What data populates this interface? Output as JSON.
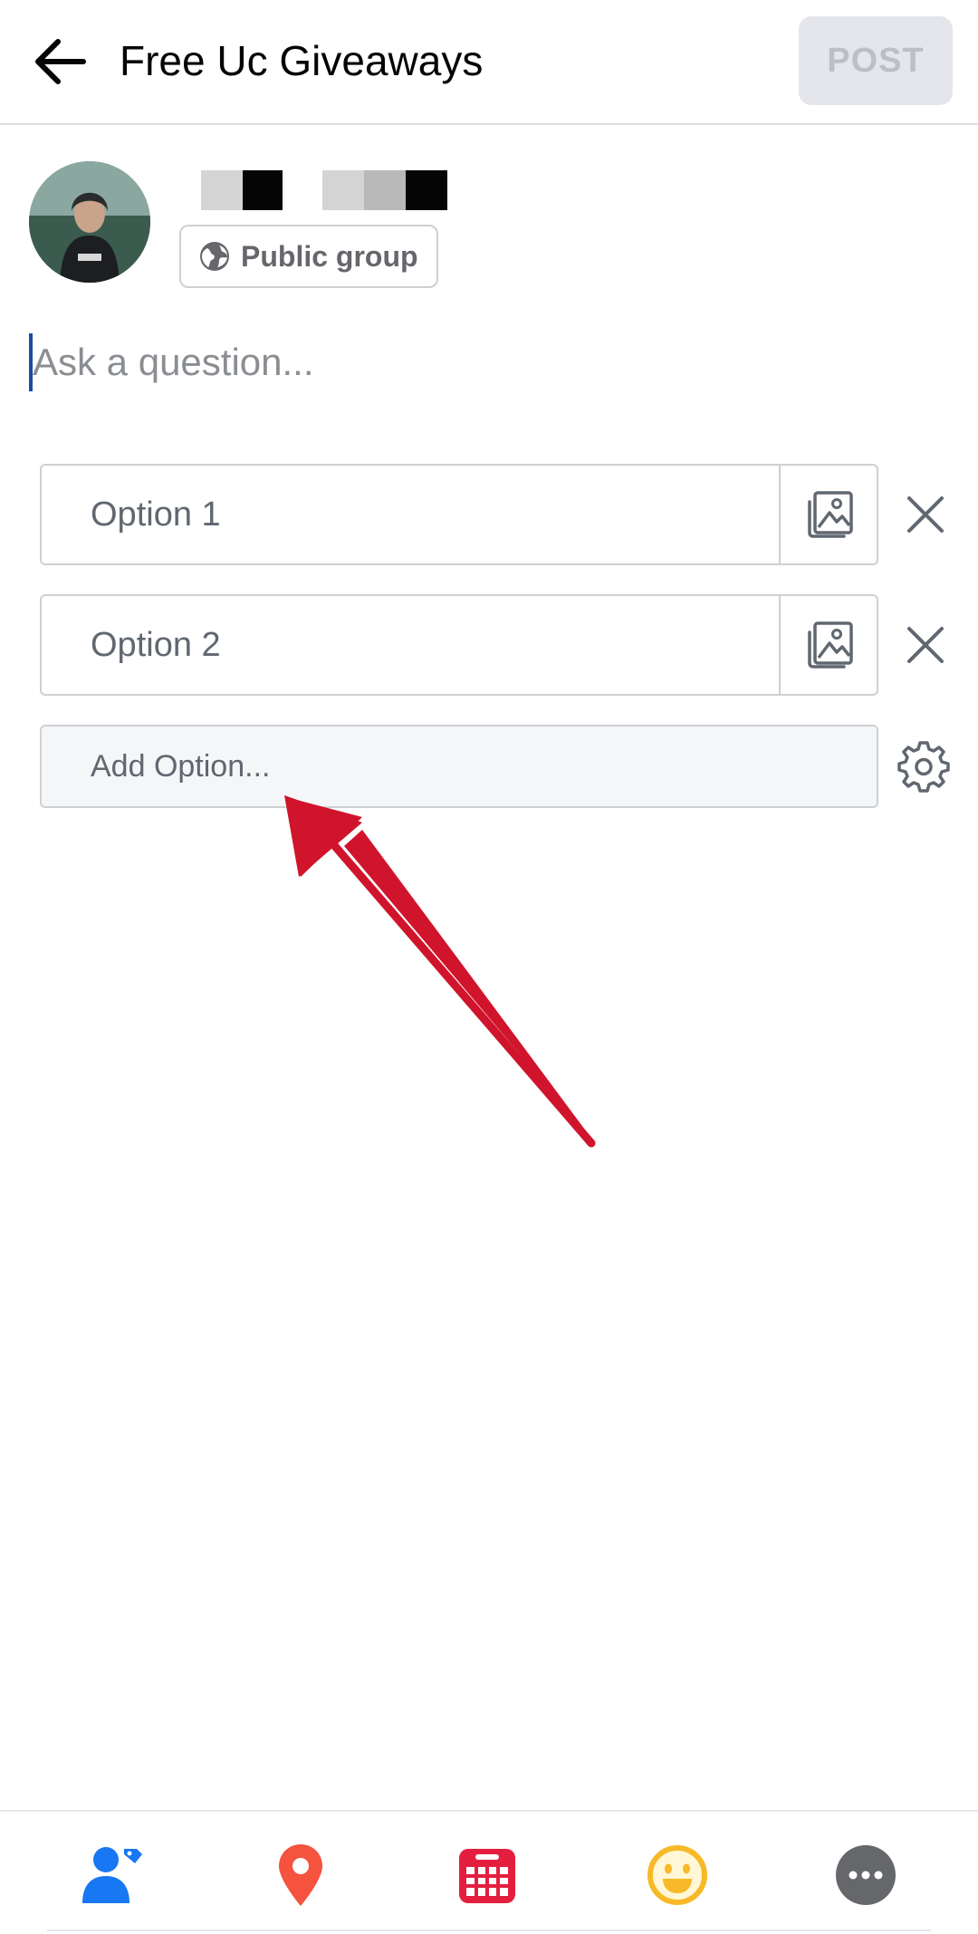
{
  "header": {
    "title": "Free Uc Giveaways",
    "post_label": "POST"
  },
  "author": {
    "audience_label": "Public group"
  },
  "composer": {
    "question_placeholder": "Ask a question..."
  },
  "poll": {
    "options": [
      {
        "label": "Option 1"
      },
      {
        "label": "Option 2"
      }
    ],
    "add_option_label": "Add Option..."
  },
  "toolbar": {
    "icons": [
      "tag-people-icon",
      "location-icon",
      "calendar-icon",
      "feeling-icon",
      "more-icon"
    ]
  },
  "colors": {
    "accent_blue": "#1877f2",
    "location_red": "#f5533d",
    "calendar_red": "#e41e3f",
    "feeling_yellow": "#f7b928",
    "more_gray": "#65676b",
    "annotation_red": "#d0142c",
    "post_disabled_bg": "#e4e6eb"
  }
}
